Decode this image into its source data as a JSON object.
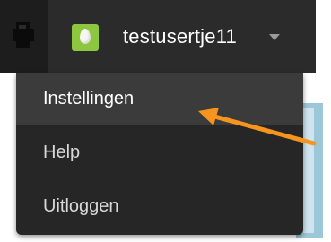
{
  "topbar": {
    "user": {
      "username": "testusertje11",
      "avatar_icon": "egg-avatar-icon"
    }
  },
  "dropdown": {
    "items": [
      {
        "label": "Instellingen",
        "active": true
      },
      {
        "label": "Help",
        "active": false
      },
      {
        "label": "Uitloggen",
        "active": false
      }
    ]
  },
  "annotation": {
    "arrow_color": "#f7941d"
  }
}
